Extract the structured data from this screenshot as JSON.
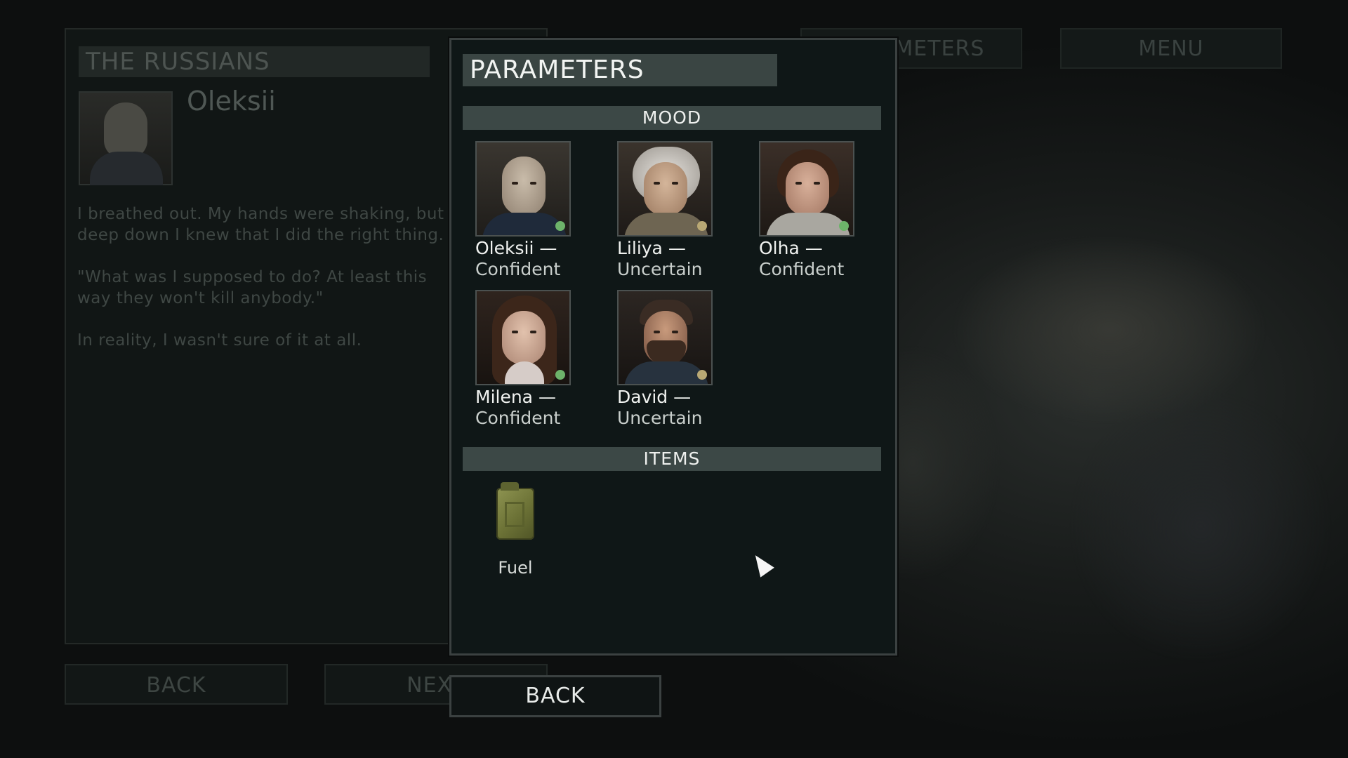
{
  "background": {
    "story": {
      "title": "THE RUSSIANS",
      "character_name": "Oleksii",
      "paragraphs": [
        "I breathed out. My hands were shaking, but deep down I knew that I did the right thing.",
        "\"What was I supposed to do? At least this way they won't kill anybody.\"",
        "In reality, I wasn't sure of it at all."
      ]
    },
    "buttons": {
      "back": "BACK",
      "next": "NEXT"
    },
    "tabs": {
      "parameters": "PARAMETERS",
      "menu": "MENU"
    }
  },
  "modal": {
    "title": "PARAMETERS",
    "mood_header": "MOOD",
    "items_header": "ITEMS",
    "characters": [
      {
        "name": "Oleksii —",
        "mood": "Confident",
        "mood_color": "#6db36a"
      },
      {
        "name": "Liliya —",
        "mood": "Uncertain",
        "mood_color": "#b9a874"
      },
      {
        "name": "Olha —",
        "mood": "Confident",
        "mood_color": "#6db36a"
      },
      {
        "name": "Milena —",
        "mood": "Confident",
        "mood_color": "#6db36a"
      },
      {
        "name": "David —",
        "mood": "Uncertain",
        "mood_color": "#b9a874"
      }
    ],
    "items": [
      {
        "label": "Fuel",
        "icon": "jerrycan-icon"
      }
    ],
    "back_label": "BACK"
  },
  "colors": {
    "confident": "#6db36a",
    "uncertain": "#b9a874",
    "section_bar": "#3c4846",
    "modal_bg": "#0f1717"
  }
}
